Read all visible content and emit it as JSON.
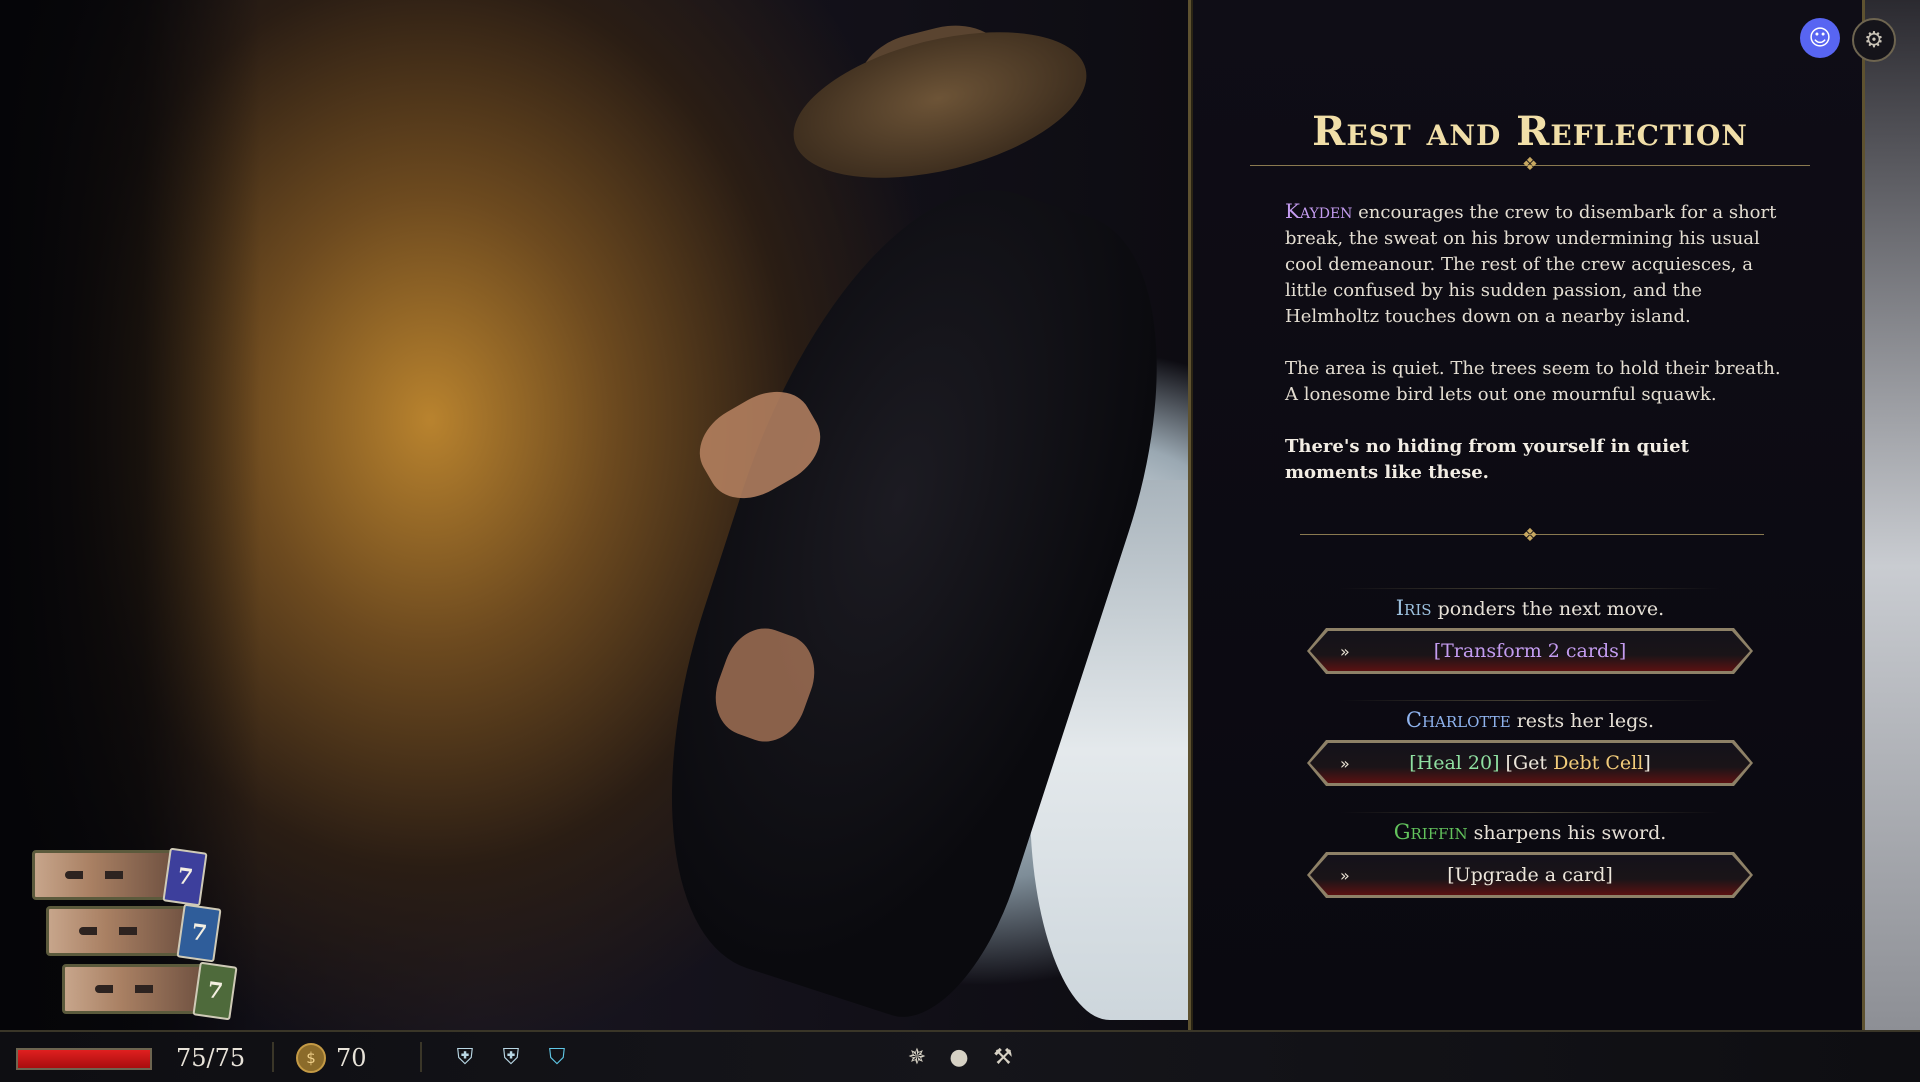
{
  "event": {
    "title": "Rest and Reflection",
    "paragraph1_name": "Kayden",
    "paragraph1_rest": " encourages the crew to disembark for a short break, the sweat on his brow undermining his usual cool demeanour. The rest of the crew acquiesces, a little confused by his sudden passion, and the Helmholtz touches down on a nearby island.",
    "paragraph2": "The area is quiet. The trees seem to hold their breath. A lonesome bird lets out one mournful squawk.",
    "paragraph3": "There's no hiding from yourself in quiet moments like these."
  },
  "choices": [
    {
      "character": "Iris",
      "caption": " ponders the next move.",
      "action_text": "[Transform 2 cards]",
      "arrow": "»"
    },
    {
      "character": "Charlotte",
      "caption": " rests her legs.",
      "action_part1": "[Heal 20]",
      "action_part2": " [Get ",
      "action_part3": "Debt Cell",
      "action_part4": "]",
      "arrow": "»"
    },
    {
      "character": "Griffin",
      "caption": " sharpens his sword.",
      "action_text": "[Upgrade a card]",
      "arrow": "»"
    }
  ],
  "party": [
    {
      "deck_count": "7",
      "deck_color": "#3d3f9c"
    },
    {
      "deck_count": "7",
      "deck_color": "#2f5d9a"
    },
    {
      "deck_count": "7",
      "deck_color": "#4e6a3b"
    }
  ],
  "hud": {
    "hp_text": "75/75",
    "hp_fraction": 1.0,
    "gold": "70",
    "coin_symbol": "$"
  },
  "icons": {
    "discord": "discord-icon",
    "settings": "gear-icon",
    "status": [
      "shield-crest-icon",
      "shield-crest-icon",
      "shield-icon"
    ],
    "relics": [
      "burst-icon",
      "sack-icon",
      "axe-icon"
    ]
  },
  "colors": {
    "title": "#f1dfa8",
    "kayden": "#c49cf0",
    "iris": "#9cc0dd",
    "charlotte": "#8fb3ee",
    "griffin": "#62c25c",
    "hp": "#e02020"
  }
}
